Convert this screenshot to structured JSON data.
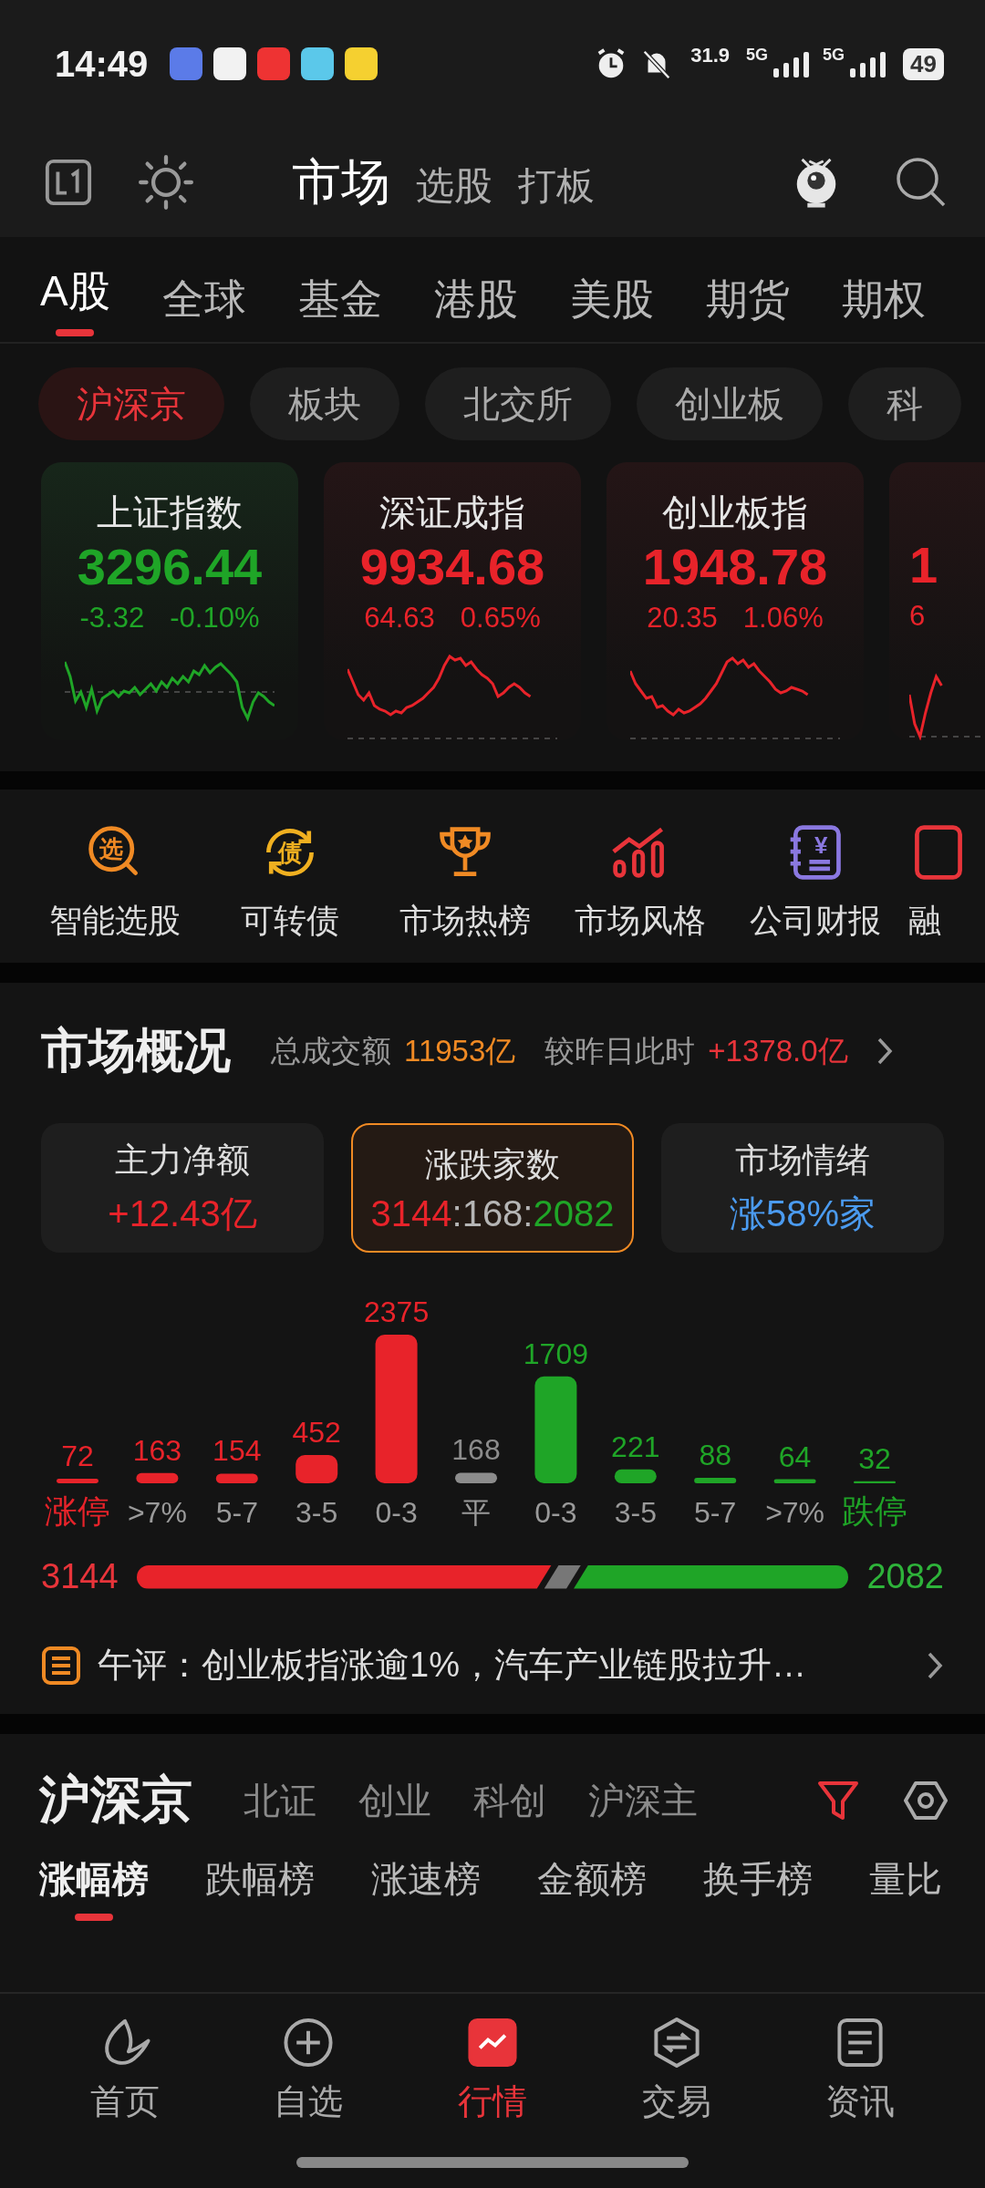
{
  "status_bar": {
    "time": "14:49",
    "speed": "31.9",
    "network_labels": [
      "5G",
      "5G"
    ],
    "battery": "49"
  },
  "header": {
    "tabs": [
      {
        "label": "市场",
        "selected": true
      },
      {
        "label": "选股",
        "selected": false
      },
      {
        "label": "打板",
        "selected": false
      }
    ]
  },
  "category_tabs": [
    {
      "label": "A股",
      "selected": true
    },
    {
      "label": "全球",
      "selected": false
    },
    {
      "label": "基金",
      "selected": false
    },
    {
      "label": "港股",
      "selected": false
    },
    {
      "label": "美股",
      "selected": false
    },
    {
      "label": "期货",
      "selected": false
    },
    {
      "label": "期权",
      "selected": false
    }
  ],
  "exchange_chips": [
    {
      "label": "沪深京",
      "selected": true
    },
    {
      "label": "板块",
      "selected": false
    },
    {
      "label": "北交所",
      "selected": false
    },
    {
      "label": "创业板",
      "selected": false
    },
    {
      "label": "科",
      "selected": false
    }
  ],
  "index_cards": [
    {
      "name": "上证指数",
      "value": "3296.44",
      "change": "-3.32",
      "percent": "-0.10%",
      "kind": "fall"
    },
    {
      "name": "深证成指",
      "value": "9934.68",
      "change": "64.63",
      "percent": "0.65%",
      "kind": "rise"
    },
    {
      "name": "创业板指",
      "value": "1948.78",
      "change": "20.35",
      "percent": "1.06%",
      "kind": "rise"
    },
    {
      "value": "1",
      "change": "6",
      "kind": "rise"
    }
  ],
  "shortcuts": [
    {
      "label": "智能选股",
      "kind": "pick",
      "glyph": "选"
    },
    {
      "label": "可转债",
      "kind": "cycle",
      "glyph": "债"
    },
    {
      "label": "市场热榜",
      "kind": "trophy"
    },
    {
      "label": "市场风格",
      "kind": "chart"
    },
    {
      "label": "公司财报",
      "kind": "ledger",
      "glyph": "¥"
    },
    {
      "label": "融",
      "kind": "doc"
    }
  ],
  "overview": {
    "title": "市场概况",
    "turnover_label": "总成交额",
    "turnover": "11953亿",
    "compare_label": "较昨日此时",
    "compare": "+1378.0亿",
    "stats": [
      {
        "label": "主力净额",
        "selected": false,
        "parts": [
          {
            "text": "+12.43亿",
            "kind": "rise"
          }
        ]
      },
      {
        "label": "涨跌家数",
        "selected": true,
        "parts": [
          {
            "text": "3144",
            "kind": "rise"
          },
          {
            "text": ":168:",
            "kind": "flat"
          },
          {
            "text": "2082",
            "kind": "fall"
          }
        ]
      },
      {
        "label": "市场情绪",
        "selected": false,
        "parts": [
          {
            "text": "涨58%家",
            "kind": "info"
          }
        ]
      }
    ],
    "chart_data": {
      "type": "bar",
      "categories": [
        "涨停",
        ">7%",
        "5-7",
        "3-5",
        "0-3",
        "平",
        "0-3",
        "3-5",
        "5-7",
        ">7%",
        "跌停"
      ],
      "data_labels": true,
      "values": [
        72,
        163,
        154,
        452,
        2375,
        168,
        1709,
        221,
        88,
        64,
        32
      ]
    },
    "breadth": {
      "up": {
        "count": "3144"
      },
      "down": {
        "count": "2082"
      }
    },
    "commentary": "午评：创业板指涨逾1%，汽车产业链股拉升…"
  },
  "list": {
    "market_tabs": [
      {
        "label": "沪深京",
        "selected": true
      },
      {
        "label": "北证",
        "selected": false
      },
      {
        "label": "创业",
        "selected": false
      },
      {
        "label": "科创",
        "selected": false
      },
      {
        "label": "沪深主",
        "selected": false
      }
    ],
    "rank_tabs": [
      {
        "label": "涨幅榜",
        "selected": true
      },
      {
        "label": "跌幅榜",
        "selected": false
      },
      {
        "label": "涨速榜",
        "selected": false
      },
      {
        "label": "金额榜",
        "selected": false
      },
      {
        "label": "换手榜",
        "selected": false
      },
      {
        "label": "量比",
        "selected": false
      }
    ]
  },
  "bottom_nav": [
    {
      "label": "首页",
      "kind": "home",
      "selected": false
    },
    {
      "label": "自选",
      "kind": "add",
      "selected": false
    },
    {
      "label": "行情",
      "kind": "market",
      "selected": true
    },
    {
      "label": "交易",
      "kind": "trade",
      "selected": false
    },
    {
      "label": "资讯",
      "kind": "news",
      "selected": false
    }
  ]
}
